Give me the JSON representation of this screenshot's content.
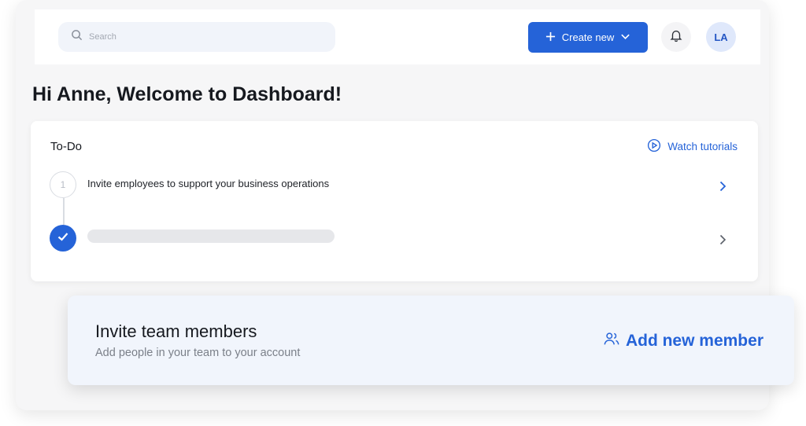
{
  "header": {
    "search_placeholder": "Search",
    "create_label": "Create new",
    "avatar_initials": "LA"
  },
  "page": {
    "title": "Hi Anne, Welcome to Dashboard!"
  },
  "todo": {
    "title": "To-Do",
    "watch_label": "Watch tutorials",
    "steps": [
      {
        "number": "1",
        "text": "Invite employees to support your business operations",
        "status": "pending"
      },
      {
        "number": "",
        "text": "",
        "status": "completed"
      }
    ]
  },
  "invite": {
    "title": "Invite team members",
    "subtitle": "Add people in your team to your account",
    "action_label": "Add new member"
  },
  "colors": {
    "accent": "#2563d8",
    "background": "#f6f6f7",
    "invite_bg": "#f1f5fc"
  }
}
